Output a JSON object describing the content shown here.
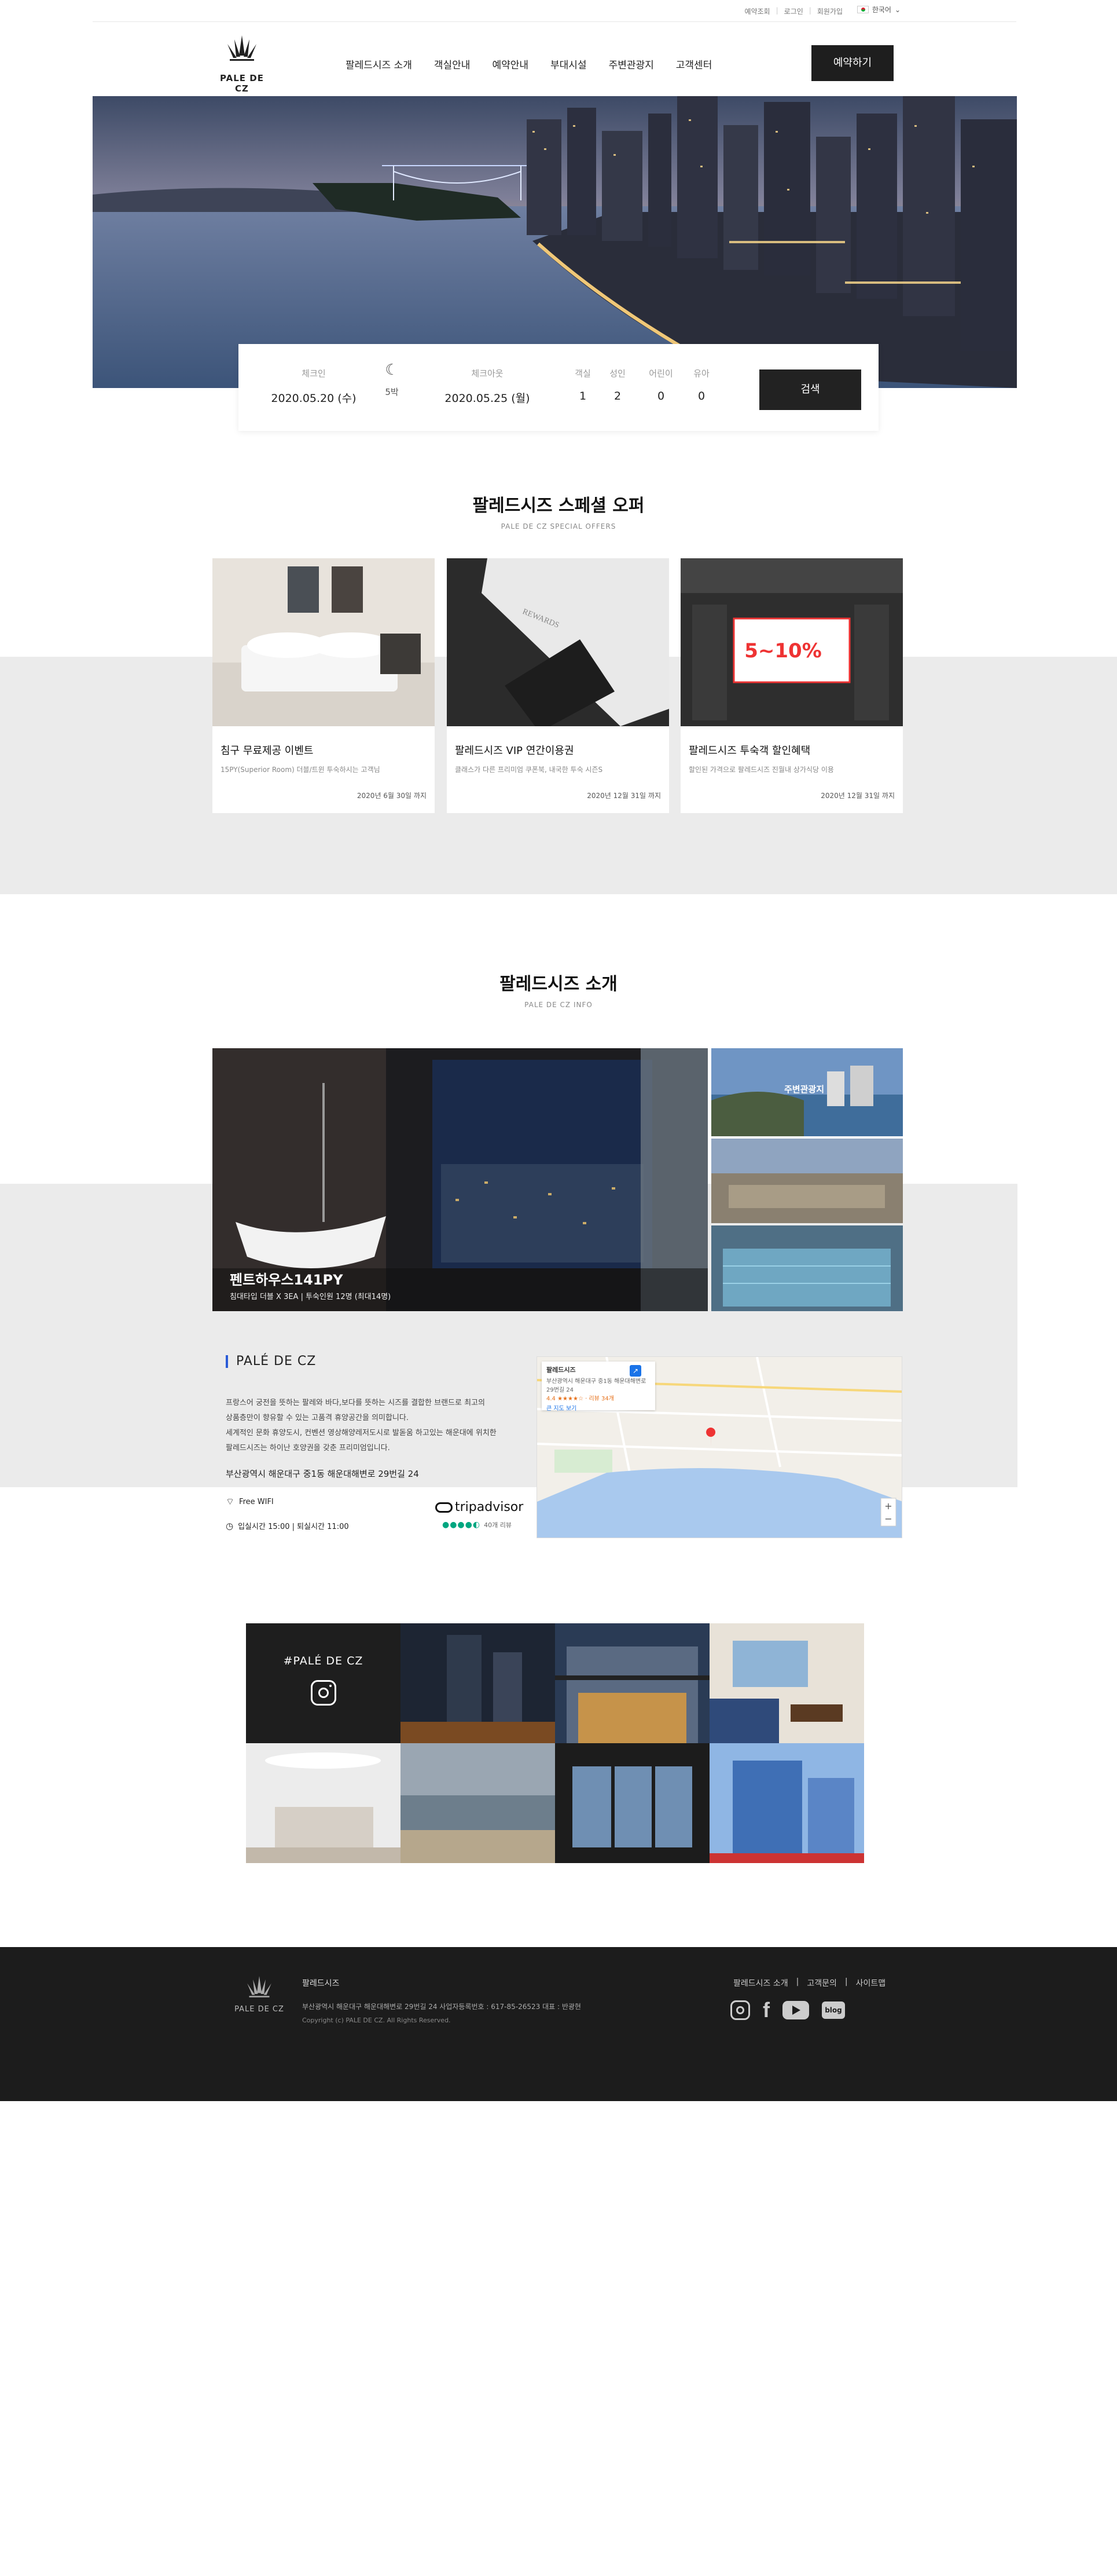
{
  "util": {
    "links": [
      "예약조회",
      "로그인",
      "회원가입"
    ],
    "language": "한국어"
  },
  "header": {
    "logo_text": "PALE DE CZ",
    "nav": [
      "팔레드시즈 소개",
      "객실안내",
      "예약안내",
      "부대시설",
      "주변관광지",
      "고객센터"
    ],
    "book_button": "예약하기"
  },
  "search": {
    "checkin_label": "체크인",
    "checkin_value": "2020.05.20 (수)",
    "nights_value": "5박",
    "checkout_label": "체크아웃",
    "checkout_value": "2020.05.25 (월)",
    "rooms_label": "객실",
    "rooms_value": "1",
    "adults_label": "성인",
    "adults_value": "2",
    "children_label": "어린이",
    "children_value": "0",
    "infants_label": "유아",
    "infants_value": "0",
    "search_button": "검색"
  },
  "offers": {
    "title": "팔레드시즈 스페셜 오퍼",
    "subtitle": "PALE DE CZ SPECIAL OFFERS",
    "badge_text": "5~10%",
    "cards": [
      {
        "title": "침구 무료제공 이벤트",
        "desc": "15PY(Superior Room) 더블/트윈 투숙하시는 고객님",
        "date": "2020년 6월 30일 까지"
      },
      {
        "title": "팔레드시즈 VIP 연간이용권",
        "desc": "클래스가 다른 프리미엄 쿠폰북, 내국한 투숙 시즌S",
        "date": "2020년 12월 31일 까지"
      },
      {
        "title": "팔레드시즈 투숙객 할인혜택",
        "desc": "할인된 가격으로 팔레드시즈 진월내 상가식당 이용",
        "date": "2020년 12월 31일 까지"
      }
    ]
  },
  "info": {
    "title": "팔레드시즈 소개",
    "subtitle": "PALE DE CZ INFO",
    "room_name": "펜트하우스141PY",
    "room_desc": "침대타입  더블 X 3EA  |  투숙인원  12명 (최대14명)",
    "side_label": "주변관광지",
    "brand": "PALÉ DE CZ",
    "body_lines": [
      "프랑스어 궁전을 뜻하는 팔레와 바다,보다를 뜻하는 시즈를 결합한 브랜드로 최고의",
      "상품층만이 향유할 수 있는 고품격 휴양공간을 의미합니다.",
      "세계적인 문화 휴양도시, 컨벤션 영상해양레저도시로 발돋움 하고있는 해운대에 위치한",
      "팔레드시즈는 하이난 호양권을 갖춘 프리미엄입니다."
    ],
    "address": "부산광역시 해운대구 중1동 해운대해변로 29번길 24",
    "wifi": "Free WIFI",
    "checkin_time": "입실시간 15:00  |  퇴실시간 11:00",
    "trip_label": "tripadvisor",
    "trip_reviews": "40개 리뷰",
    "map_title": "팔레드시즈",
    "map_lines": [
      "부산광역시 해운대구 중1동 해운대해변로",
      "29번길 24",
      "4.4 ★★★★☆ · 리뷰 34개"
    ],
    "map_link": "큰 지도 보기"
  },
  "insta": {
    "tag": "#PALÉ DE CZ"
  },
  "footer": {
    "name": "팔레드시즈",
    "address": "부산광역시 해운대구 해운대해변로 29번길 24     사업자등록번호 : 617-85-26523     대표 : 반광현",
    "copyright": "Copyright (c) PALE DE CZ. All Rights Reserved.",
    "links": [
      "팔레드시즈 소개",
      "고객문의",
      "사이트맵"
    ],
    "blog": "blog"
  }
}
